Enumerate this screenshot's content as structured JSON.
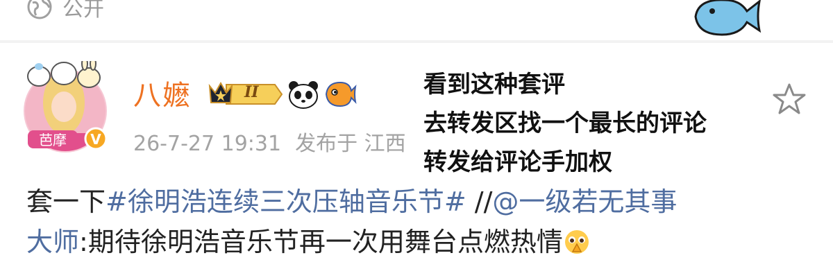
{
  "header": {
    "privacy_label": "公开",
    "privacy_icon": "globe-icon"
  },
  "post": {
    "author": {
      "name": "八嬷",
      "avatar_caption": "芭摩",
      "verified_badge": "V",
      "vip_level": "II"
    },
    "meta": {
      "timestamp": "26-7-27 19:31",
      "location": "发布于 江西"
    },
    "overlay_lines": [
      "看到这种套评",
      "去转发区找一个最长的评论",
      "转发给评论手加权"
    ],
    "content": {
      "prefix": "套一下",
      "hashtag": "#徐明浩连续三次压轴音乐节#",
      "repost_marker": " //",
      "mention_line1": "@一级若无其事",
      "mention_line2": "大师",
      "quote_text": ":期待徐明浩音乐节再一次用舞台点燃热情"
    }
  },
  "colors": {
    "username": "#ee7222",
    "link": "#4f6da0",
    "meta": "#a3a3a3",
    "text": "#222222"
  }
}
